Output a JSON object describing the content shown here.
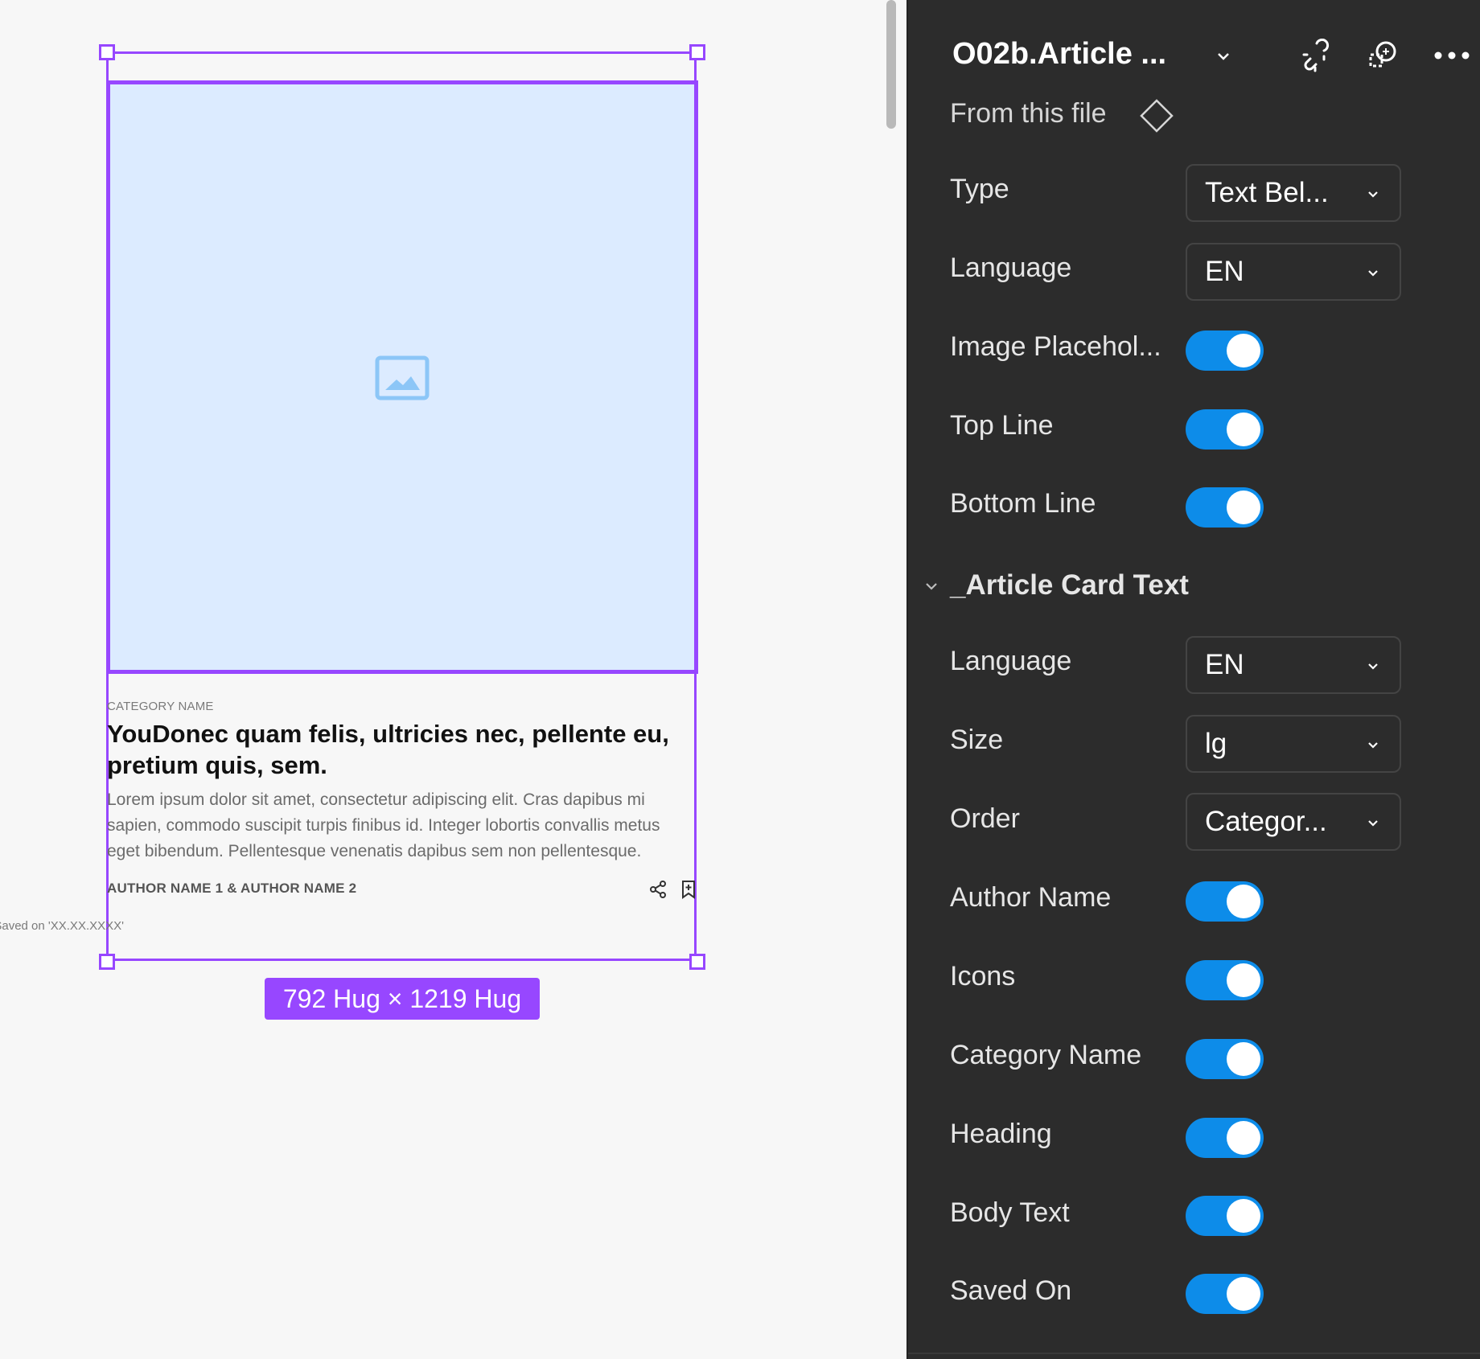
{
  "canvas": {
    "card": {
      "category_name": "CATEGORY NAME",
      "heading": "YouDonec quam felis, ultricies nec, pellente eu, pretium quis, sem.",
      "body_text": "Lorem ipsum dolor sit amet, consectetur adipiscing elit. Cras dapibus mi sapien, commodo suscipit turpis finibus id. Integer lobortis convallis metus eget bibendum. Pellentesque venenatis dapibus sem non pellentesque.",
      "author": "AUTHOR NAME 1 & AUTHOR NAME 2",
      "saved_on": "Saved on 'XX.XX.XXXX'",
      "image_icon": "image-placeholder-icon"
    },
    "size_badge": "792 Hug × 1219 Hug",
    "selection_color": "#9747ff",
    "placeholder_color": "#dcebff"
  },
  "panel": {
    "title": "O02b.Article ...",
    "from_file": "From this file",
    "icons": [
      "chevron-down-icon",
      "detach-instance-icon",
      "swap-instance-icon",
      "more-icon",
      "component-diamond-icon"
    ],
    "properties": {
      "type": {
        "label": "Type",
        "value": "Text Bel..."
      },
      "language": {
        "label": "Language",
        "value": "EN"
      },
      "image_placeholder": {
        "label": "Image Placehol...",
        "on": true
      },
      "top_line": {
        "label": "Top Line",
        "on": true
      },
      "bottom_line": {
        "label": "Bottom Line",
        "on": true
      }
    },
    "section": {
      "title": "_Article Card Text",
      "language": {
        "label": "Language",
        "value": "EN"
      },
      "size": {
        "label": "Size",
        "value": "lg"
      },
      "order": {
        "label": "Order",
        "value": "Categor..."
      },
      "author_name": {
        "label": "Author Name",
        "on": true
      },
      "icons": {
        "label": "Icons",
        "on": true
      },
      "category_name": {
        "label": "Category Name",
        "on": true
      },
      "heading": {
        "label": "Heading",
        "on": true
      },
      "body_text": {
        "label": "Body Text",
        "on": true
      },
      "saved_on": {
        "label": "Saved On",
        "on": true
      }
    },
    "toggle_color": "#0d8ce9"
  }
}
